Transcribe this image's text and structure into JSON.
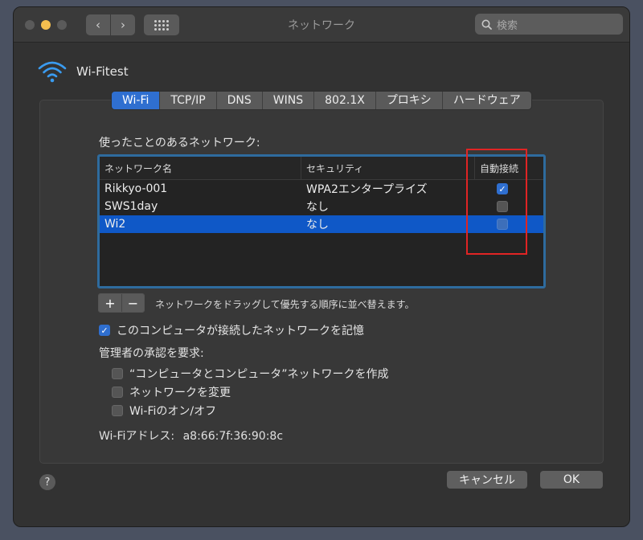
{
  "window": {
    "title": "ネットワーク"
  },
  "search": {
    "placeholder": "検索"
  },
  "header": {
    "title": "Wi-Fitest"
  },
  "tabs": [
    {
      "label": "Wi-Fi",
      "active": true
    },
    {
      "label": "TCP/IP"
    },
    {
      "label": "DNS"
    },
    {
      "label": "WINS"
    },
    {
      "label": "802.1X"
    },
    {
      "label": "プロキシ"
    },
    {
      "label": "ハードウェア"
    }
  ],
  "networks": {
    "section_label": "使ったことのあるネットワーク:",
    "columns": [
      "ネットワーク名",
      "セキュリティ",
      "自動接続"
    ],
    "rows": [
      {
        "name": "Rikkyo-001",
        "security": "WPA2エンタープライズ",
        "auto": true
      },
      {
        "name": "SWS1day",
        "security": "なし",
        "auto": false
      },
      {
        "name": "Wi2",
        "security": "なし",
        "auto": false,
        "selected": true
      }
    ],
    "add_label": "+",
    "remove_label": "−",
    "hint": "ネットワークをドラッグして優先する順序に並べ替えます。"
  },
  "remember_network": {
    "label": "このコンピュータが接続したネットワークを記憶",
    "checked": true
  },
  "admin": {
    "label": "管理者の承認を要求:",
    "options": [
      {
        "label": "“コンピュータとコンピュータ”ネットワークを作成",
        "checked": false
      },
      {
        "label": "ネットワークを変更",
        "checked": false
      },
      {
        "label": "Wi-Fiのオン/オフ",
        "checked": false
      }
    ]
  },
  "wifi_address": {
    "label": "Wi-Fiアドレス:",
    "value": "a8:66:7f:36:90:8c"
  },
  "buttons": {
    "help": "?",
    "cancel": "キャンセル",
    "ok": "OK"
  },
  "colors": {
    "accent": "#2f6fd0",
    "selected_row": "#0f58c7",
    "annotation": "#e02424"
  }
}
